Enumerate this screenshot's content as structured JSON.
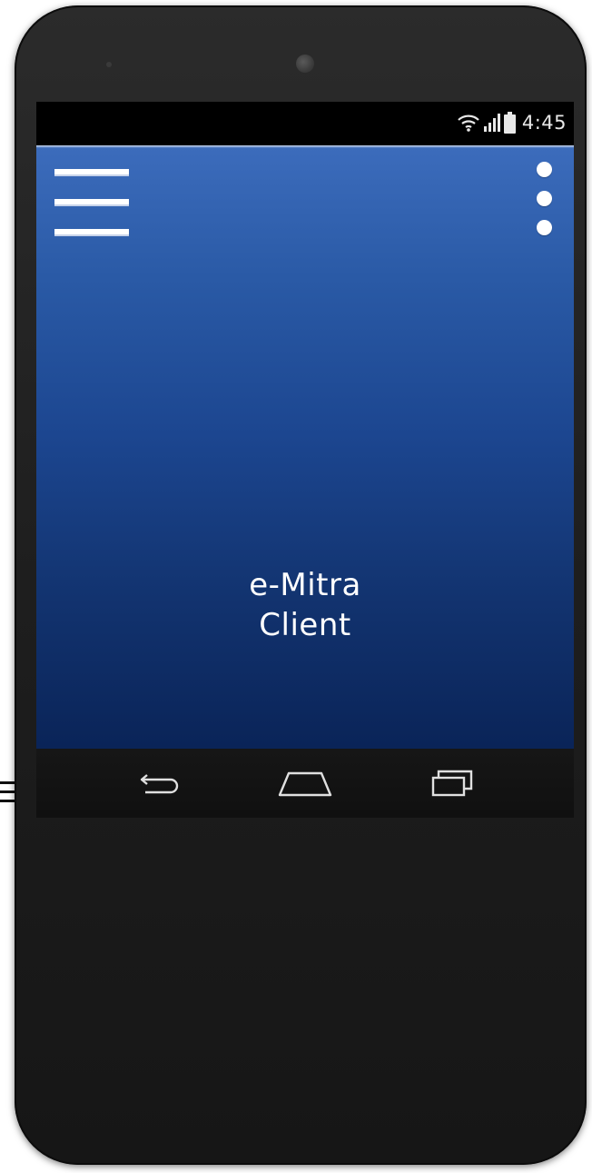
{
  "status_bar": {
    "time": "4:45",
    "icons": [
      "wifi-icon",
      "signal-icon",
      "battery-icon"
    ]
  },
  "app": {
    "title_line1": "e-Mitra",
    "title_line2": "Client",
    "background_top": "#3c6cbc",
    "background_bottom": "#0a2458"
  },
  "toolbar": {
    "menu_icon": "hamburger-menu-icon",
    "overflow_icon": "overflow-menu-icon"
  },
  "navigation": {
    "buttons": [
      "back-icon",
      "home-icon",
      "recent-apps-icon"
    ]
  }
}
